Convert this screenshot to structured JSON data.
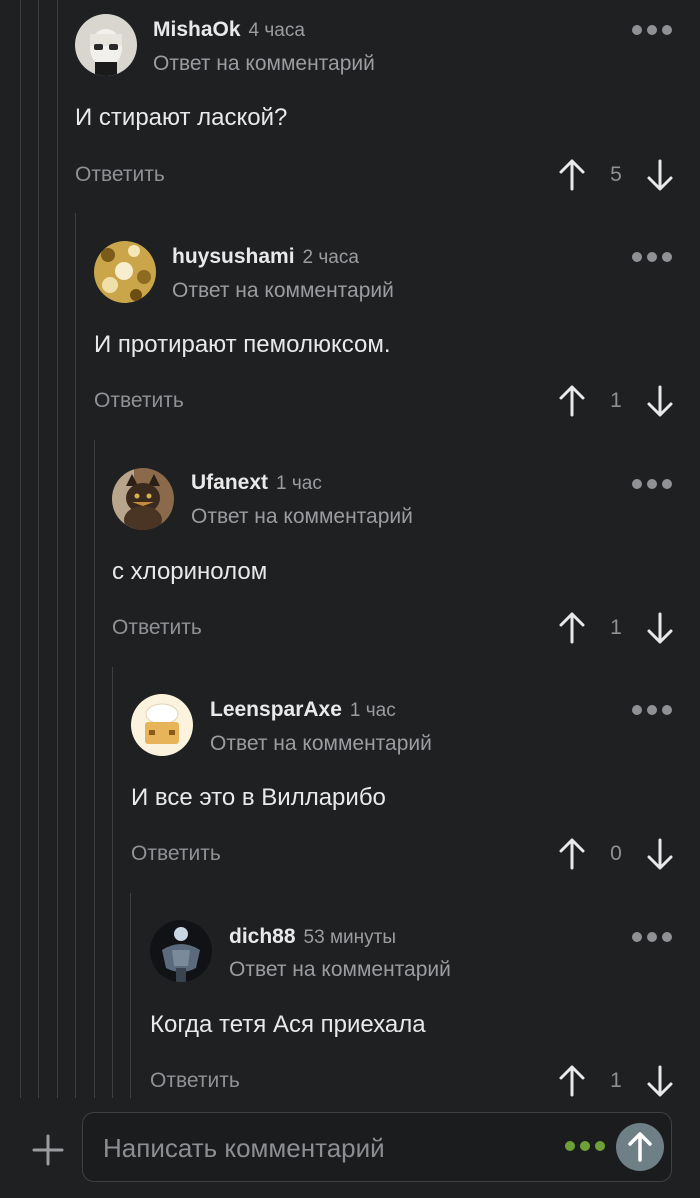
{
  "comments": [
    {
      "username": "MishaOk",
      "time": "4 часа",
      "reply_label": "Ответ на комментарий",
      "text": "И стирают лаской?",
      "reply_button": "Ответить",
      "score": "5",
      "avatar": "man-with-glasses-avatar"
    },
    {
      "username": "huysushami",
      "time": "2 часа",
      "reply_label": "Ответ на комментарий",
      "text": "И протирают пемолюксом.",
      "reply_button": "Ответить",
      "score": "1",
      "avatar": "gold-pattern-avatar"
    },
    {
      "username": "Ufanext",
      "time": "1 час",
      "reply_label": "Ответ на комментарий",
      "text": "с хлоринолом",
      "reply_button": "Ответить",
      "score": "1",
      "avatar": "cat-avatar"
    },
    {
      "username": "LeensparAxe",
      "time": "1 час",
      "reply_label": "Ответ на комментарий",
      "text": "И все это в Вилларибо",
      "reply_button": "Ответить",
      "score": "0",
      "avatar": "chef-avatar"
    },
    {
      "username": "dich88",
      "time": "53 минуты",
      "reply_label": "Ответ на комментарий",
      "text": "Когда тетя Ася приехала",
      "reply_button": "Ответить",
      "score": "1",
      "avatar": "muscle-figure-avatar"
    }
  ],
  "composer": {
    "placeholder": "Написать комментарий",
    "accent": "#6fa037",
    "send_color": "#6f7f86"
  },
  "colors": {
    "background": "#1e2022",
    "thread_line": "#3c3f43"
  }
}
